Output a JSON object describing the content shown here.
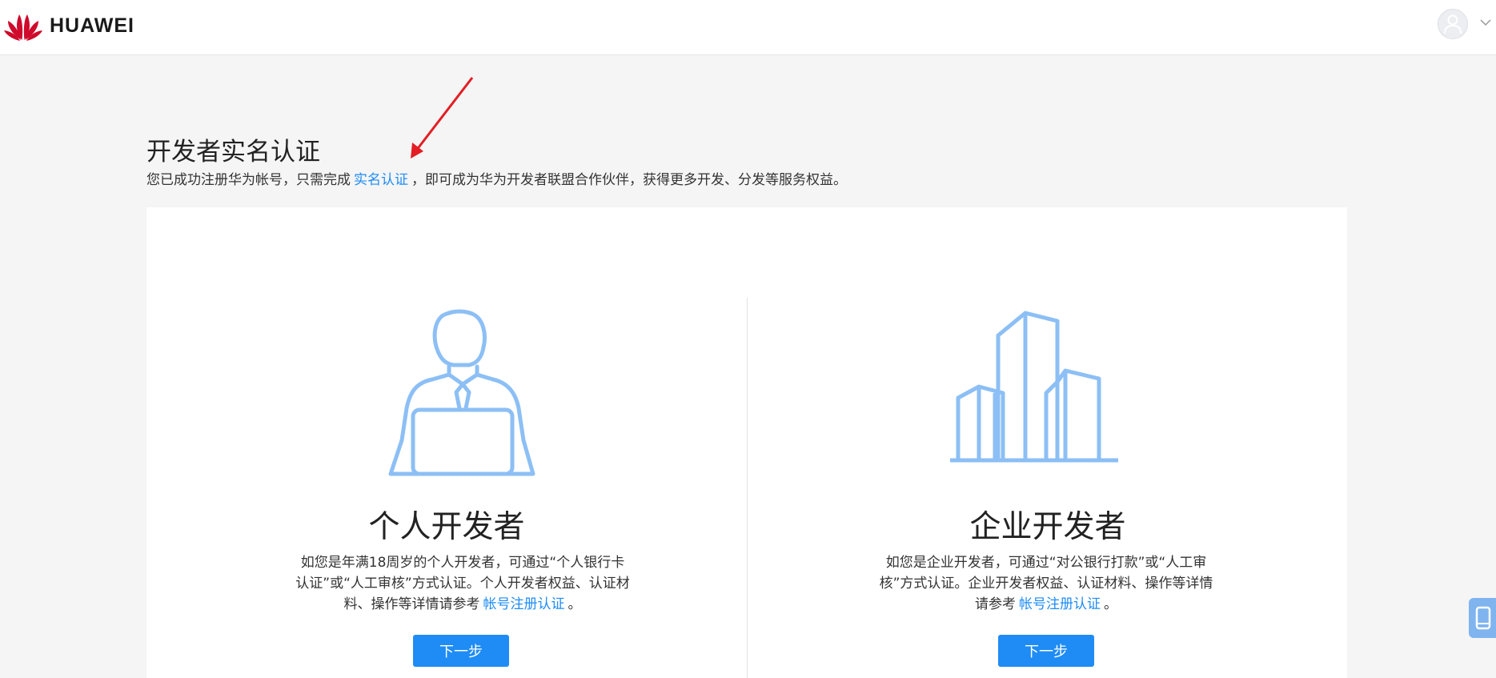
{
  "header": {
    "brand": "HUAWEI",
    "icons": [
      "huawei-logo",
      "user-avatar-icon",
      "chevron-down-icon"
    ]
  },
  "intro": {
    "title": "开发者实名认证",
    "subtitle_before": "您已成功注册华为帐号，只需完成",
    "subtitle_link": "实名认证",
    "subtitle_after": "，即可成为华为开发者联盟合作伙伴，获得更多开发、分发等服务权益。"
  },
  "individual": {
    "title": "个人开发者",
    "desc_before": "如您是年满18周岁的个人开发者，可通过“个人银行卡认证”或“人工审核”方式认证。个人开发者权益、认证材料、操作等详情请参考",
    "desc_link": "帐号注册认证",
    "desc_after": "。",
    "button": "下一步"
  },
  "enterprise": {
    "title": "企业开发者",
    "desc_before": "如您是企业开发者，可通过“对公银行打款”或“人工审核”方式认证。企业开发者权益、认证材料、操作等详情请参考",
    "desc_link": "帐号注册认证",
    "desc_after": "。",
    "button": "下一步"
  },
  "colors": {
    "accent": "#1f8cf5",
    "illustration": "#8cbff5",
    "brand_red": "#cf0a2c",
    "annotation_arrow": "#e31e24"
  }
}
